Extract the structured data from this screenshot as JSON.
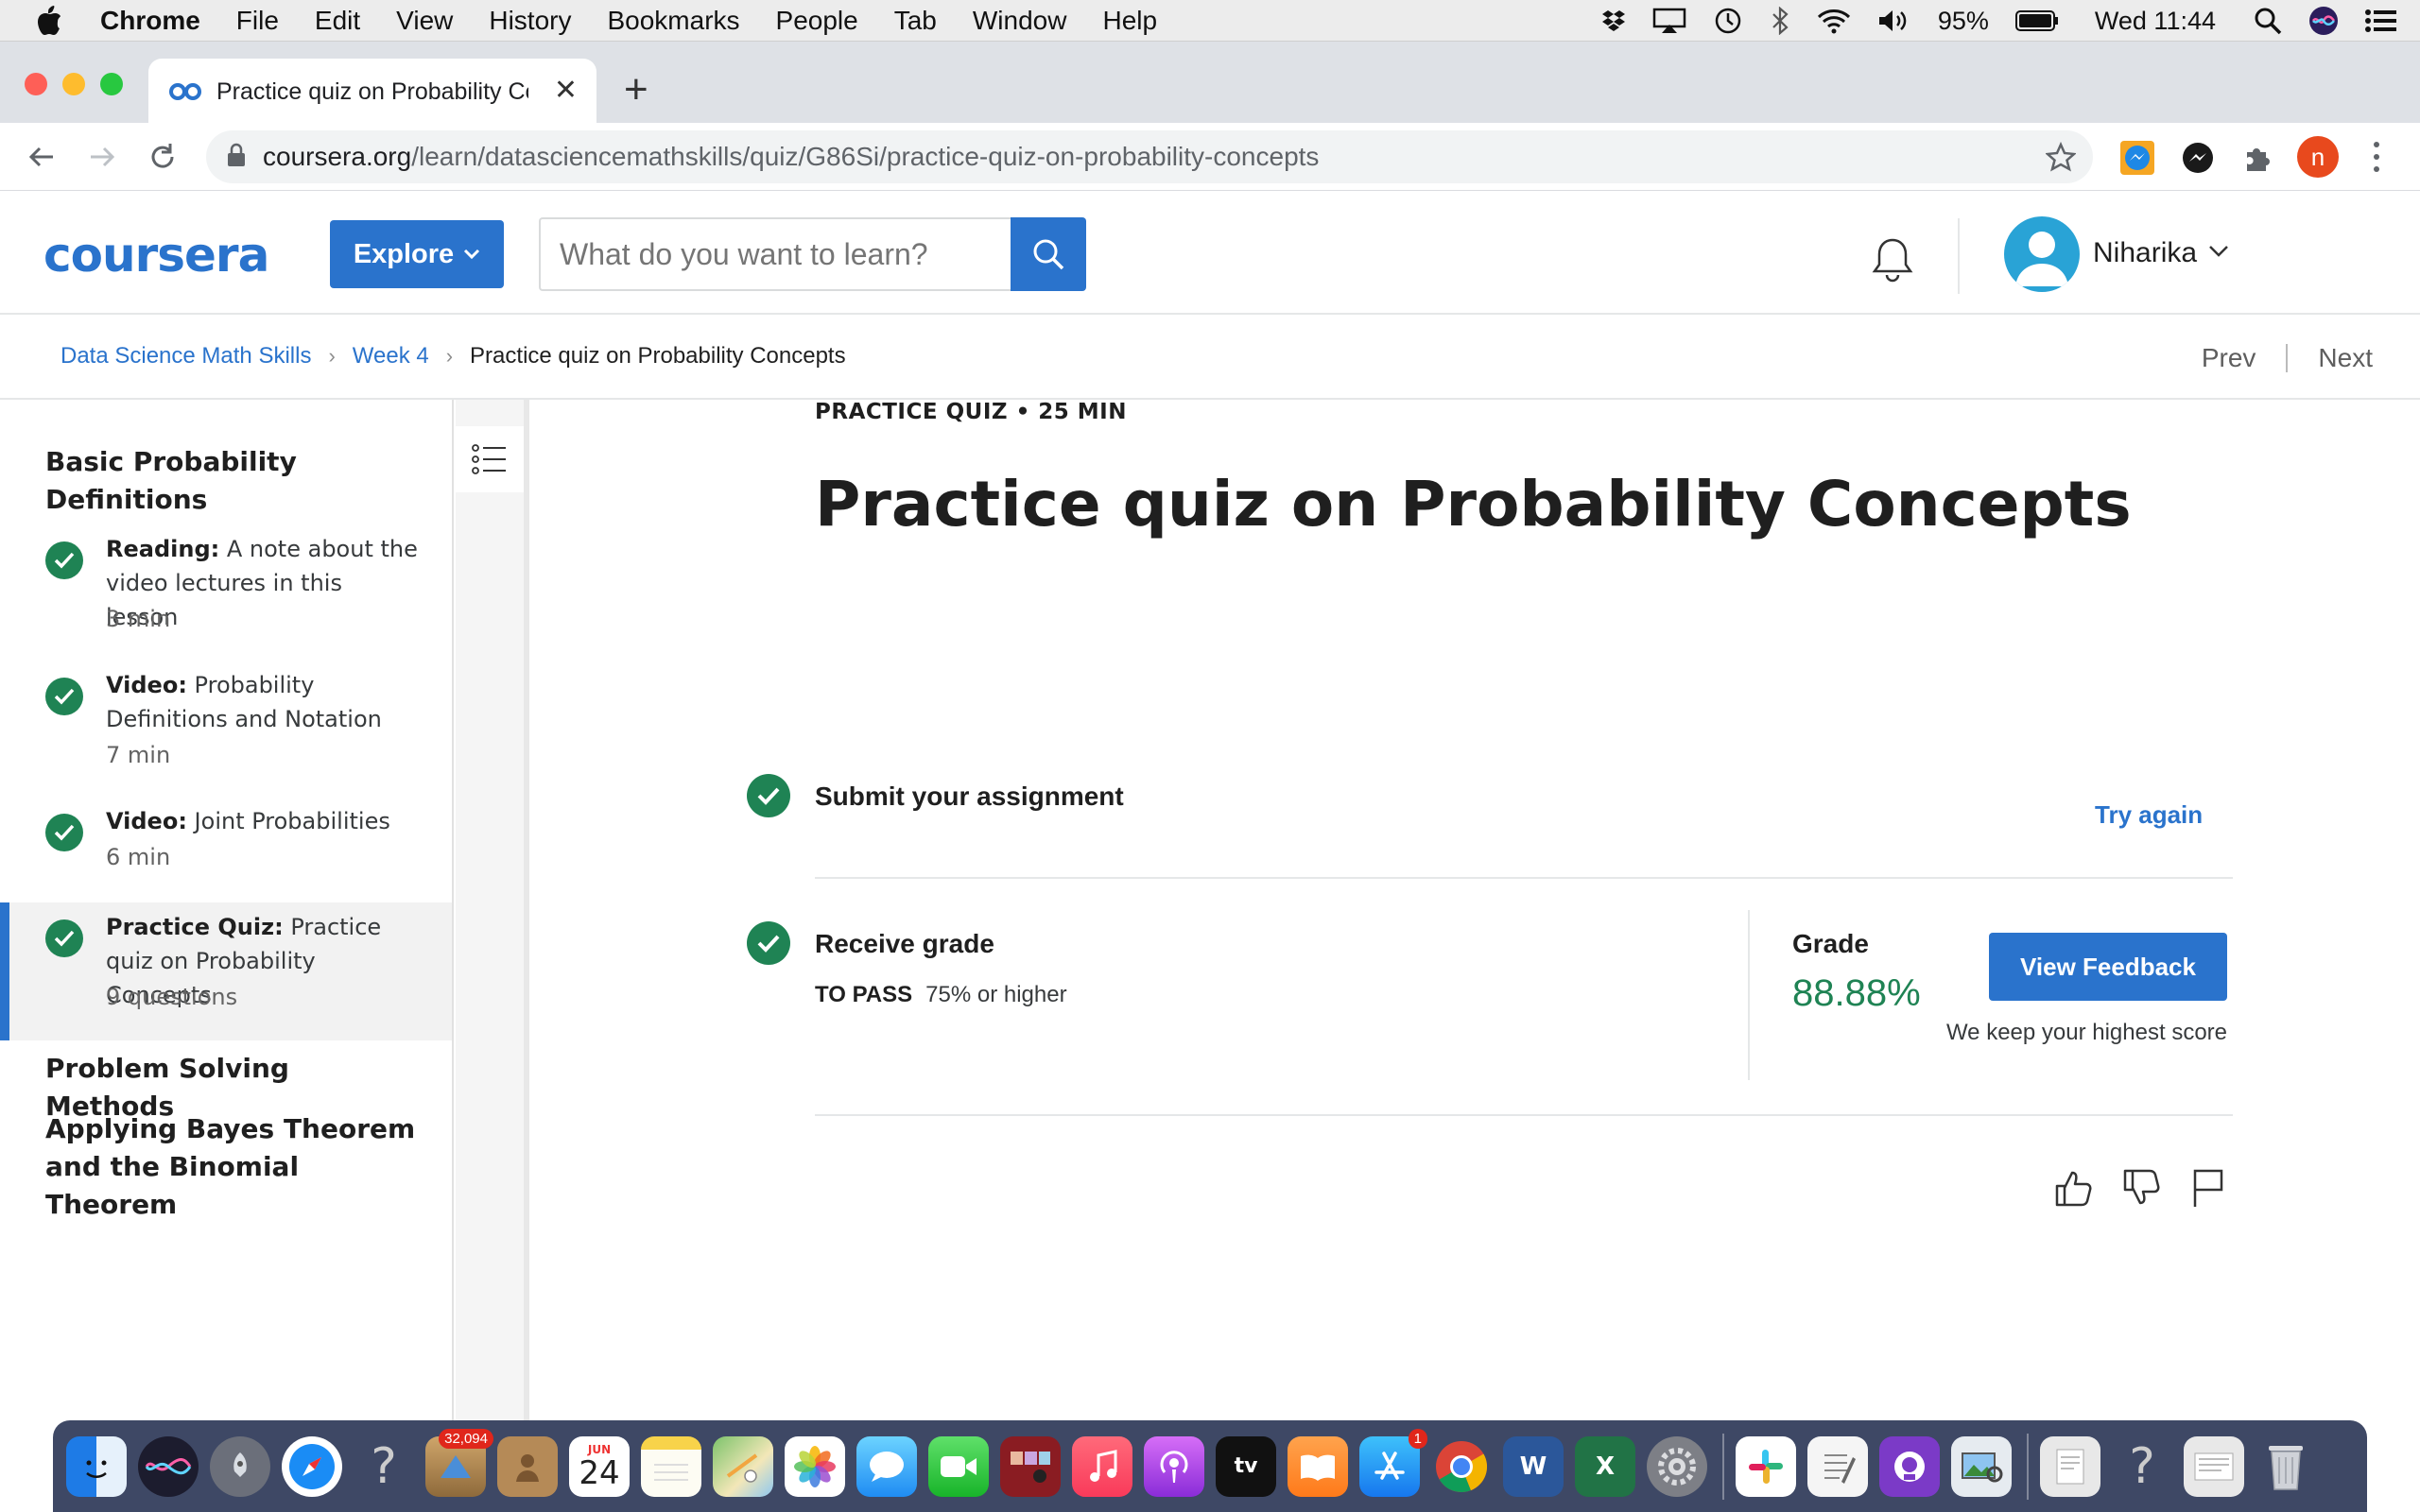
{
  "menubar": {
    "app": "Chrome",
    "items": [
      "File",
      "Edit",
      "View",
      "History",
      "Bookmarks",
      "People",
      "Tab",
      "Window",
      "Help"
    ],
    "battery": "95%",
    "clock": "Wed 11:44"
  },
  "browser": {
    "tab_title": "Practice quiz on Probability Concepts",
    "url_host": "coursera.org",
    "url_path": "/learn/datasciencemathskills/quiz/G86Si/practice-quiz-on-probability-concepts",
    "profile_initial": "n"
  },
  "header": {
    "logo": "coursera",
    "explore_label": "Explore",
    "search_placeholder": "What do you want to learn?",
    "username": "Niharika"
  },
  "breadcrumb": {
    "course": "Data Science Math Skills",
    "week": "Week 4",
    "current": "Practice quiz on Probability Concepts",
    "prev": "Prev",
    "next": "Next"
  },
  "sidebar": {
    "section1": "Basic Probability Definitions",
    "items": [
      {
        "type": "Reading:",
        "title": " A note about the video lectures in this lesson",
        "duration": "3 min"
      },
      {
        "type": "Video:",
        "title": " Probability Definitions and Notation",
        "duration": "7 min"
      },
      {
        "type": "Video:",
        "title": " Joint Probabilities",
        "duration": "6 min"
      },
      {
        "type": "Practice Quiz:",
        "title": " Practice quiz on Probability Concepts",
        "duration": "9 questions"
      }
    ],
    "section2": "Problem Solving Methods",
    "section3": "Applying Bayes Theorem and the Binomial Theorem"
  },
  "main": {
    "kicker": "PRACTICE QUIZ • 25 MIN",
    "title": "Practice quiz on Probability Concepts",
    "submit_label": "Submit your assignment",
    "try_again": "Try again",
    "receive_label": "Receive grade",
    "to_pass_label": "TO PASS",
    "to_pass_value": "75% or higher",
    "grade_label": "Grade",
    "grade_value": "88.88%",
    "view_feedback": "View Feedback",
    "keep_note": "We keep your highest score"
  },
  "dock": {
    "mail_badge": "32,094",
    "calendar_month": "JUN",
    "calendar_day": "24",
    "appstore_badge": "1"
  },
  "colors": {
    "accent": "#2a73cc",
    "success": "#1f8354"
  }
}
